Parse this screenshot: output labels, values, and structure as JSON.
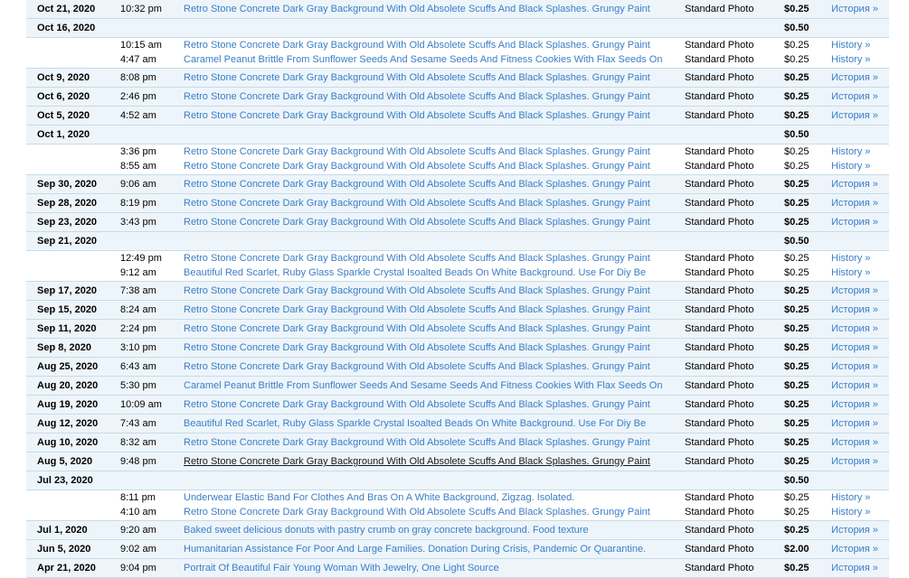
{
  "rows": [
    {
      "kind": "single",
      "date": "Oct 21, 2020",
      "time": "10:32 pm",
      "title": "Retro Stone Concrete Dark Gray Background With Old Absolete Scuffs And Black Splashes. Grungy Paint",
      "type": "Standard Photo",
      "price": "$0.25",
      "history": "История »"
    },
    {
      "kind": "group",
      "date": "Oct 16, 2020",
      "total": "$0.50"
    },
    {
      "kind": "sub",
      "time": "10:15 am",
      "title": "Retro Stone Concrete Dark Gray Background With Old Absolete Scuffs And Black Splashes. Grungy Paint",
      "type": "Standard Photo",
      "price": "$0.25",
      "history": "History »"
    },
    {
      "kind": "sub",
      "last": true,
      "time": "4:47 am",
      "title": "Caramel Peanut Brittle From Sunflower Seeds And Sesame Seeds And Fitness Cookies With Flax Seeds On",
      "type": "Standard Photo",
      "price": "$0.25",
      "history": "History »"
    },
    {
      "kind": "single",
      "date": "Oct 9, 2020",
      "time": "8:08 pm",
      "title": "Retro Stone Concrete Dark Gray Background With Old Absolete Scuffs And Black Splashes. Grungy Paint",
      "type": "Standard Photo",
      "price": "$0.25",
      "history": "История »"
    },
    {
      "kind": "single",
      "date": "Oct 6, 2020",
      "time": "2:46 pm",
      "title": "Retro Stone Concrete Dark Gray Background With Old Absolete Scuffs And Black Splashes. Grungy Paint",
      "type": "Standard Photo",
      "price": "$0.25",
      "history": "История »"
    },
    {
      "kind": "single",
      "date": "Oct 5, 2020",
      "time": "4:52 am",
      "title": "Retro Stone Concrete Dark Gray Background With Old Absolete Scuffs And Black Splashes. Grungy Paint",
      "type": "Standard Photo",
      "price": "$0.25",
      "history": "История »"
    },
    {
      "kind": "group",
      "date": "Oct 1, 2020",
      "total": "$0.50"
    },
    {
      "kind": "sub",
      "time": "3:36 pm",
      "title": "Retro Stone Concrete Dark Gray Background With Old Absolete Scuffs And Black Splashes. Grungy Paint",
      "type": "Standard Photo",
      "price": "$0.25",
      "history": "History »"
    },
    {
      "kind": "sub",
      "last": true,
      "time": "8:55 am",
      "title": "Retro Stone Concrete Dark Gray Background With Old Absolete Scuffs And Black Splashes. Grungy Paint",
      "type": "Standard Photo",
      "price": "$0.25",
      "history": "History »"
    },
    {
      "kind": "single",
      "date": "Sep 30, 2020",
      "time": "9:06 am",
      "title": "Retro Stone Concrete Dark Gray Background With Old Absolete Scuffs And Black Splashes. Grungy Paint",
      "type": "Standard Photo",
      "price": "$0.25",
      "history": "История »"
    },
    {
      "kind": "single",
      "date": "Sep 28, 2020",
      "time": "8:19 pm",
      "title": "Retro Stone Concrete Dark Gray Background With Old Absolete Scuffs And Black Splashes. Grungy Paint",
      "type": "Standard Photo",
      "price": "$0.25",
      "history": "История »"
    },
    {
      "kind": "single",
      "date": "Sep 23, 2020",
      "time": "3:43 pm",
      "title": "Retro Stone Concrete Dark Gray Background With Old Absolete Scuffs And Black Splashes. Grungy Paint",
      "type": "Standard Photo",
      "price": "$0.25",
      "history": "История »"
    },
    {
      "kind": "group",
      "date": "Sep 21, 2020",
      "total": "$0.50"
    },
    {
      "kind": "sub",
      "time": "12:49 pm",
      "title": "Retro Stone Concrete Dark Gray Background With Old Absolete Scuffs And Black Splashes. Grungy Paint",
      "type": "Standard Photo",
      "price": "$0.25",
      "history": "History »"
    },
    {
      "kind": "sub",
      "last": true,
      "time": "9:12 am",
      "title": "Beautiful Red Scarlet, Ruby Glass Sparkle Crystal Isoalted Beads On White Background. Use For Diy Be",
      "type": "Standard Photo",
      "price": "$0.25",
      "history": "History »"
    },
    {
      "kind": "single",
      "date": "Sep 17, 2020",
      "time": "7:38 am",
      "title": "Retro Stone Concrete Dark Gray Background With Old Absolete Scuffs And Black Splashes. Grungy Paint",
      "type": "Standard Photo",
      "price": "$0.25",
      "history": "История »"
    },
    {
      "kind": "single",
      "date": "Sep 15, 2020",
      "time": "8:24 am",
      "title": "Retro Stone Concrete Dark Gray Background With Old Absolete Scuffs And Black Splashes. Grungy Paint",
      "type": "Standard Photo",
      "price": "$0.25",
      "history": "История »"
    },
    {
      "kind": "single",
      "date": "Sep 11, 2020",
      "time": "2:24 pm",
      "title": "Retro Stone Concrete Dark Gray Background With Old Absolete Scuffs And Black Splashes. Grungy Paint",
      "type": "Standard Photo",
      "price": "$0.25",
      "history": "История »"
    },
    {
      "kind": "single",
      "date": "Sep 8, 2020",
      "time": "3:10 pm",
      "title": "Retro Stone Concrete Dark Gray Background With Old Absolete Scuffs And Black Splashes. Grungy Paint",
      "type": "Standard Photo",
      "price": "$0.25",
      "history": "История »"
    },
    {
      "kind": "single",
      "date": "Aug 25, 2020",
      "time": "6:43 am",
      "title": "Retro Stone Concrete Dark Gray Background With Old Absolete Scuffs And Black Splashes. Grungy Paint",
      "type": "Standard Photo",
      "price": "$0.25",
      "history": "История »"
    },
    {
      "kind": "single",
      "date": "Aug 20, 2020",
      "time": "5:30 pm",
      "title": "Caramel Peanut Brittle From Sunflower Seeds And Sesame Seeds And Fitness Cookies With Flax Seeds On",
      "type": "Standard Photo",
      "price": "$0.25",
      "history": "История »"
    },
    {
      "kind": "single",
      "date": "Aug 19, 2020",
      "time": "10:09 am",
      "title": "Retro Stone Concrete Dark Gray Background With Old Absolete Scuffs And Black Splashes. Grungy Paint",
      "type": "Standard Photo",
      "price": "$0.25",
      "history": "История »"
    },
    {
      "kind": "single",
      "date": "Aug 12, 2020",
      "time": "7:43 am",
      "title": "Beautiful Red Scarlet, Ruby Glass Sparkle Crystal Isoalted Beads On White Background. Use For Diy Be",
      "type": "Standard Photo",
      "price": "$0.25",
      "history": "История »"
    },
    {
      "kind": "single",
      "date": "Aug 10, 2020",
      "time": "8:32 am",
      "title": "Retro Stone Concrete Dark Gray Background With Old Absolete Scuffs And Black Splashes. Grungy Paint",
      "type": "Standard Photo",
      "price": "$0.25",
      "history": "История »"
    },
    {
      "kind": "single",
      "date": "Aug 5, 2020",
      "time": "9:48 pm",
      "title": "Retro Stone Concrete Dark Gray Background With Old Absolete Scuffs And Black Splashes. Grungy Paint",
      "hover": true,
      "type": "Standard Photo",
      "price": "$0.25",
      "history": "История »"
    },
    {
      "kind": "group",
      "date": "Jul 23, 2020",
      "total": "$0.50"
    },
    {
      "kind": "sub",
      "time": "8:11 pm",
      "title": "Underwear Elastic Band For Clothes And Bras On A White Background, Zigzag. Isolated.",
      "type": "Standard Photo",
      "price": "$0.25",
      "history": "History »"
    },
    {
      "kind": "sub",
      "last": true,
      "time": "4:10 am",
      "title": "Retro Stone Concrete Dark Gray Background With Old Absolete Scuffs And Black Splashes. Grungy Paint",
      "type": "Standard Photo",
      "price": "$0.25",
      "history": "History »"
    },
    {
      "kind": "single",
      "date": "Jul 1, 2020",
      "time": "9:20 am",
      "title": "Baked sweet delicious donuts with pastry crumb on gray concrete background. Food texture",
      "type": "Standard Photo",
      "price": "$0.25",
      "history": "История »"
    },
    {
      "kind": "single",
      "date": "Jun 5, 2020",
      "time": "9:02 am",
      "title": "Humanitarian Assistance For Poor And Large Families. Donation During Crisis, Pandemic Or Quarantine.",
      "type": "Standard Photo",
      "price": "$2.00",
      "history": "История »"
    },
    {
      "kind": "single",
      "date": "Apr 21, 2020",
      "time": "9:04 pm",
      "title": "Portrait Of Beautiful Fair Young Woman With Jewelry, One Light Source",
      "type": "Standard Photo",
      "price": "$0.25",
      "history": "История »"
    }
  ]
}
